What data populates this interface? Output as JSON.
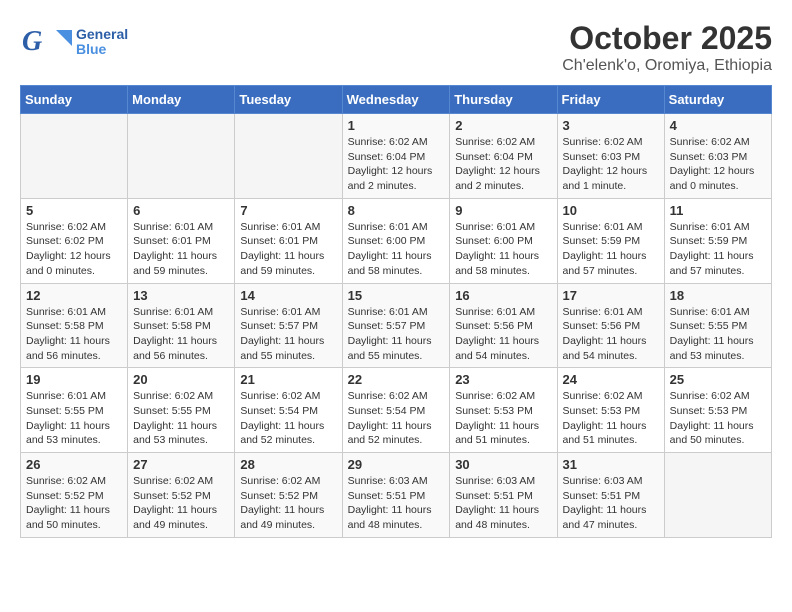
{
  "logo": {
    "general": "General",
    "blue": "Blue"
  },
  "title": "October 2025",
  "subtitle": "Ch'elenk'o, Oromiya, Ethiopia",
  "weekdays": [
    "Sunday",
    "Monday",
    "Tuesday",
    "Wednesday",
    "Thursday",
    "Friday",
    "Saturday"
  ],
  "weeks": [
    [
      {
        "day": "",
        "info": ""
      },
      {
        "day": "",
        "info": ""
      },
      {
        "day": "",
        "info": ""
      },
      {
        "day": "1",
        "info": "Sunrise: 6:02 AM\nSunset: 6:04 PM\nDaylight: 12 hours\nand 2 minutes."
      },
      {
        "day": "2",
        "info": "Sunrise: 6:02 AM\nSunset: 6:04 PM\nDaylight: 12 hours\nand 2 minutes."
      },
      {
        "day": "3",
        "info": "Sunrise: 6:02 AM\nSunset: 6:03 PM\nDaylight: 12 hours\nand 1 minute."
      },
      {
        "day": "4",
        "info": "Sunrise: 6:02 AM\nSunset: 6:03 PM\nDaylight: 12 hours\nand 0 minutes."
      }
    ],
    [
      {
        "day": "5",
        "info": "Sunrise: 6:02 AM\nSunset: 6:02 PM\nDaylight: 12 hours\nand 0 minutes."
      },
      {
        "day": "6",
        "info": "Sunrise: 6:01 AM\nSunset: 6:01 PM\nDaylight: 11 hours\nand 59 minutes."
      },
      {
        "day": "7",
        "info": "Sunrise: 6:01 AM\nSunset: 6:01 PM\nDaylight: 11 hours\nand 59 minutes."
      },
      {
        "day": "8",
        "info": "Sunrise: 6:01 AM\nSunset: 6:00 PM\nDaylight: 11 hours\nand 58 minutes."
      },
      {
        "day": "9",
        "info": "Sunrise: 6:01 AM\nSunset: 6:00 PM\nDaylight: 11 hours\nand 58 minutes."
      },
      {
        "day": "10",
        "info": "Sunrise: 6:01 AM\nSunset: 5:59 PM\nDaylight: 11 hours\nand 57 minutes."
      },
      {
        "day": "11",
        "info": "Sunrise: 6:01 AM\nSunset: 5:59 PM\nDaylight: 11 hours\nand 57 minutes."
      }
    ],
    [
      {
        "day": "12",
        "info": "Sunrise: 6:01 AM\nSunset: 5:58 PM\nDaylight: 11 hours\nand 56 minutes."
      },
      {
        "day": "13",
        "info": "Sunrise: 6:01 AM\nSunset: 5:58 PM\nDaylight: 11 hours\nand 56 minutes."
      },
      {
        "day": "14",
        "info": "Sunrise: 6:01 AM\nSunset: 5:57 PM\nDaylight: 11 hours\nand 55 minutes."
      },
      {
        "day": "15",
        "info": "Sunrise: 6:01 AM\nSunset: 5:57 PM\nDaylight: 11 hours\nand 55 minutes."
      },
      {
        "day": "16",
        "info": "Sunrise: 6:01 AM\nSunset: 5:56 PM\nDaylight: 11 hours\nand 54 minutes."
      },
      {
        "day": "17",
        "info": "Sunrise: 6:01 AM\nSunset: 5:56 PM\nDaylight: 11 hours\nand 54 minutes."
      },
      {
        "day": "18",
        "info": "Sunrise: 6:01 AM\nSunset: 5:55 PM\nDaylight: 11 hours\nand 53 minutes."
      }
    ],
    [
      {
        "day": "19",
        "info": "Sunrise: 6:01 AM\nSunset: 5:55 PM\nDaylight: 11 hours\nand 53 minutes."
      },
      {
        "day": "20",
        "info": "Sunrise: 6:02 AM\nSunset: 5:55 PM\nDaylight: 11 hours\nand 53 minutes."
      },
      {
        "day": "21",
        "info": "Sunrise: 6:02 AM\nSunset: 5:54 PM\nDaylight: 11 hours\nand 52 minutes."
      },
      {
        "day": "22",
        "info": "Sunrise: 6:02 AM\nSunset: 5:54 PM\nDaylight: 11 hours\nand 52 minutes."
      },
      {
        "day": "23",
        "info": "Sunrise: 6:02 AM\nSunset: 5:53 PM\nDaylight: 11 hours\nand 51 minutes."
      },
      {
        "day": "24",
        "info": "Sunrise: 6:02 AM\nSunset: 5:53 PM\nDaylight: 11 hours\nand 51 minutes."
      },
      {
        "day": "25",
        "info": "Sunrise: 6:02 AM\nSunset: 5:53 PM\nDaylight: 11 hours\nand 50 minutes."
      }
    ],
    [
      {
        "day": "26",
        "info": "Sunrise: 6:02 AM\nSunset: 5:52 PM\nDaylight: 11 hours\nand 50 minutes."
      },
      {
        "day": "27",
        "info": "Sunrise: 6:02 AM\nSunset: 5:52 PM\nDaylight: 11 hours\nand 49 minutes."
      },
      {
        "day": "28",
        "info": "Sunrise: 6:02 AM\nSunset: 5:52 PM\nDaylight: 11 hours\nand 49 minutes."
      },
      {
        "day": "29",
        "info": "Sunrise: 6:03 AM\nSunset: 5:51 PM\nDaylight: 11 hours\nand 48 minutes."
      },
      {
        "day": "30",
        "info": "Sunrise: 6:03 AM\nSunset: 5:51 PM\nDaylight: 11 hours\nand 48 minutes."
      },
      {
        "day": "31",
        "info": "Sunrise: 6:03 AM\nSunset: 5:51 PM\nDaylight: 11 hours\nand 47 minutes."
      },
      {
        "day": "",
        "info": ""
      }
    ]
  ]
}
